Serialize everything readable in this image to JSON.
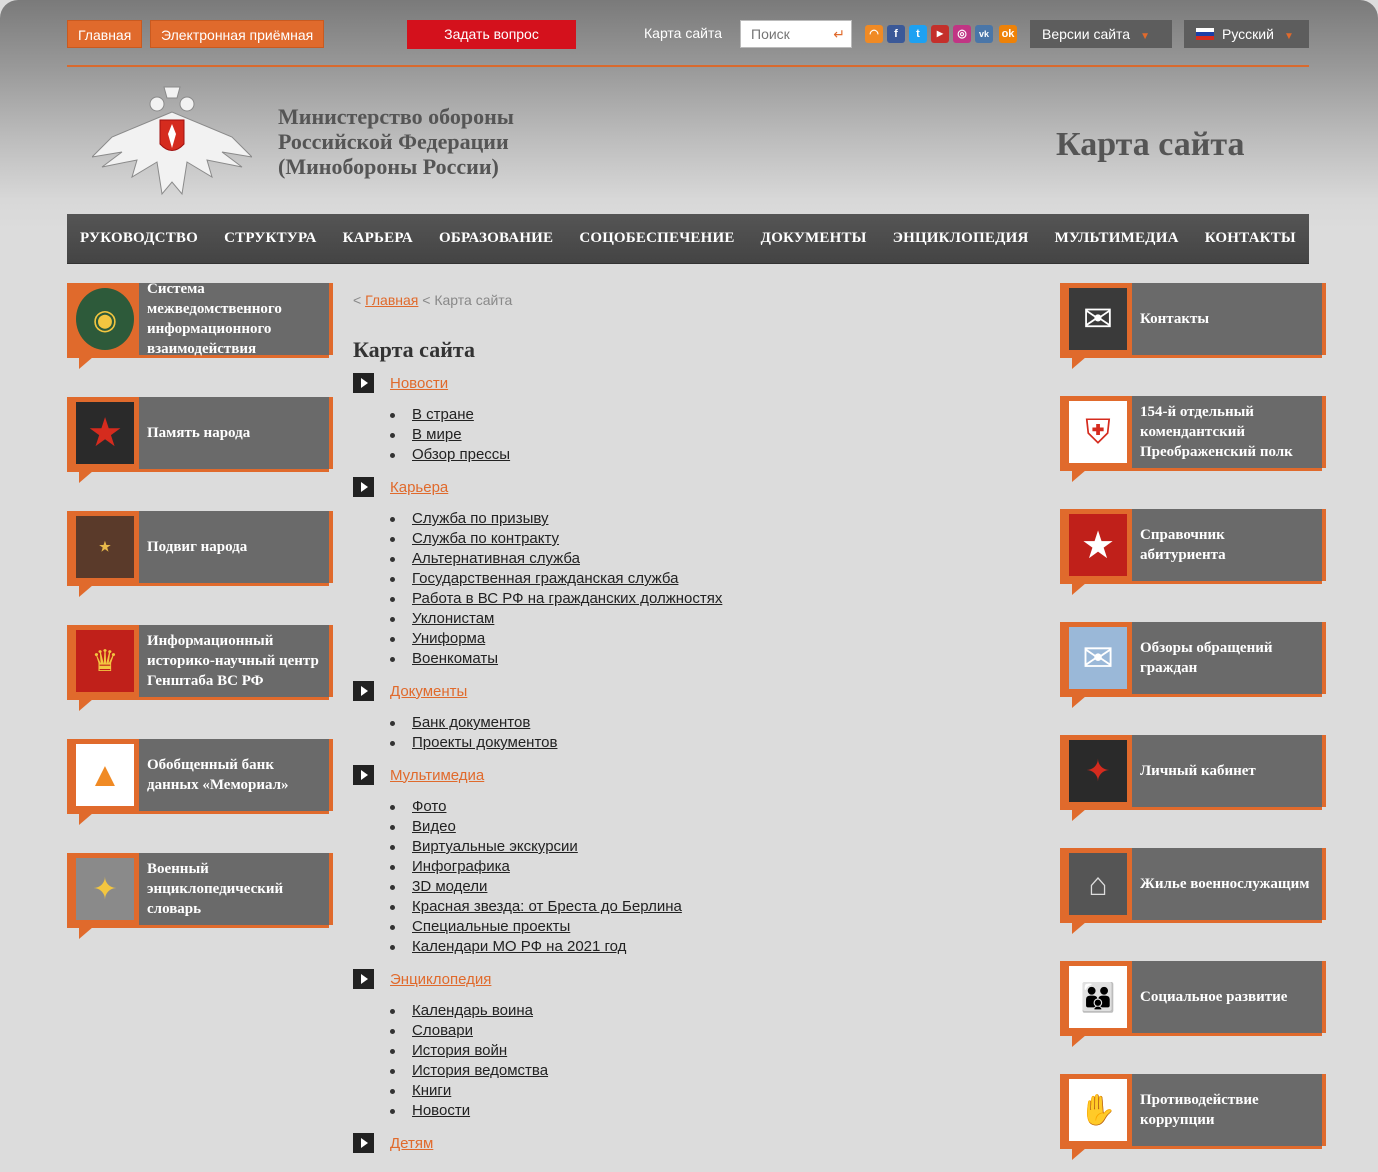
{
  "topbar": {
    "home": "Главная",
    "reception": "Электронная приёмная",
    "ask": "Задать вопрос",
    "sitemap": "Карта сайта",
    "search_placeholder": "Поиск",
    "versions": "Версии сайта",
    "language": "Русский",
    "social_icons": [
      "rss-icon",
      "facebook-icon",
      "twitter-icon",
      "youtube-icon",
      "instagram-icon",
      "vk-icon",
      "odnoklassniki-icon"
    ]
  },
  "header": {
    "ministry_line1": "Министерство обороны",
    "ministry_line2": "Российской Федерации",
    "ministry_line3": "(Минобороны России)",
    "page_title": "Карта сайта"
  },
  "nav": [
    "РУКОВОДСТВО",
    "СТРУКТУРА",
    "КАРЬЕРА",
    "ОБРАЗОВАНИЕ",
    "СОЦОБЕСПЕЧЕНИЕ",
    "ДОКУМЕНТЫ",
    "ЭНЦИКЛОПЕДИЯ",
    "МУЛЬТИМЕДИА",
    "КОНТАКТЫ"
  ],
  "left_banners": [
    "Система межведомственного информационного взаимодействия",
    "Память народа",
    "Подвиг народа",
    "Информационный историко-научный центр Генштаба ВС РФ",
    "Обобщенный банк данных «Мемориал»",
    "Военный энциклопедический словарь"
  ],
  "right_banners": [
    "Контакты",
    "154-й отдельный комендантский Преображенский полк",
    "Справочник абитуриента",
    "Обзоры обращений граждан",
    "Личный кабинет",
    "Жилье военнослужащим",
    "Социальное развитие",
    "Противодействие коррупции"
  ],
  "breadcrumb": {
    "home": "Главная",
    "current": "Карта сайта"
  },
  "content_title": "Карта сайта",
  "sections": [
    {
      "title": "Новости",
      "items": [
        "В стране",
        "В мире",
        "Обзор прессы"
      ]
    },
    {
      "title": "Карьера",
      "items": [
        "Служба по призыву",
        "Служба по контракту",
        "Альтернативная служба",
        "Государственная гражданская служба",
        "Работа в ВС РФ на гражданских должностях",
        "Уклонистам",
        "Униформа",
        "Военкоматы"
      ]
    },
    {
      "title": "Документы",
      "items": [
        "Банк документов",
        "Проекты документов"
      ]
    },
    {
      "title": "Мультимедиа",
      "items": [
        "Фото",
        "Видео",
        "Виртуальные экскурсии",
        "Инфографика",
        "3D модели",
        "Красная звезда: от Бреста до Берлина",
        "Специальные проекты",
        "Календари МО РФ на 2021 год"
      ]
    },
    {
      "title": "Энциклопедия",
      "items": [
        "Календарь воина",
        "Словари",
        "История войн",
        "История ведомства",
        "Книги",
        "Новости"
      ]
    },
    {
      "title": "Детям",
      "items": []
    }
  ]
}
